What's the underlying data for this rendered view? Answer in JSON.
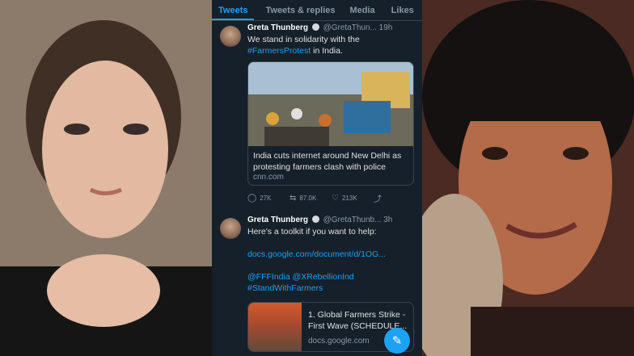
{
  "tabs": [
    "Tweets",
    "Tweets & replies",
    "Media",
    "Likes"
  ],
  "tweet1": {
    "name": "Greta Thunberg",
    "handle": "@GretaThun...",
    "time": "19h",
    "text": "We stand in solidarity with the",
    "hashtag": "#FarmersProtest",
    "text_tail": " in India.",
    "card_title": "India cuts internet around New Delhi as protesting farmers clash with police",
    "card_domain": "cnn.com",
    "replies": "27K",
    "retweets": "87.0K",
    "likes": "213K"
  },
  "tweet2": {
    "name": "Greta Thunberg",
    "handle": "@GretaThunb...",
    "time": "3h",
    "text": "Here's a toolkit if you want to help:",
    "link": "docs.google.com/document/d/1OG...",
    "mentions": "@FFFIndia @XRebellionInd",
    "hashtag": "#StandWithFarmers",
    "card_title": "1. Global Farmers Strike - First Wave (SCHEDULE...",
    "card_domain": "docs.google.com"
  },
  "icons": {
    "reply": "reply-icon",
    "retweet": "retweet-icon",
    "like": "heart-icon",
    "share": "share-icon",
    "compose": "compose-icon"
  },
  "colors": {
    "accent": "#1da1f2",
    "background": "#15202b"
  }
}
